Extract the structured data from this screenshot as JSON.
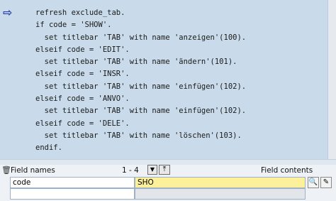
{
  "editor": {
    "lines": [
      "refresh exclude_tab.",
      "if code = 'SHOW'.",
      "  set titlebar 'TAB' with name 'anzeigen'(100).",
      "elseif code = 'EDIT'.",
      "  set titlebar 'TAB' with name 'ändern'(101).",
      "elseif code = 'INSR'.",
      "  set titlebar 'TAB' with name 'einfügen'(102).",
      "elseif code = 'ANVO'.",
      "  set titlebar 'TAB' with name 'einfügen'(102).",
      "elseif code = 'DELE'.",
      "  set titlebar 'TAB' with name 'löschen'(103).",
      "endif."
    ],
    "current_line_icon": "arrow-right-icon"
  },
  "fields_panel": {
    "field_names_label": "Field names",
    "range_text": "1 - 4",
    "field_contents_label": "Field contents",
    "rows": [
      {
        "name": "code",
        "value": "SHO"
      },
      {
        "name": "",
        "value": ""
      }
    ],
    "colors": {
      "value_highlight": "#fcf19a",
      "editor_bg": "#c9dbea"
    }
  }
}
